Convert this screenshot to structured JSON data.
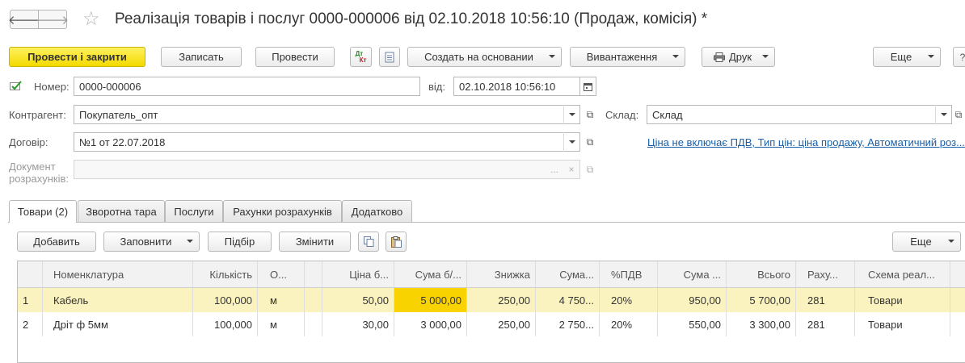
{
  "window": {
    "title": "Реалізація товарів і послуг 0000-000006 від 02.10.2018 10:56:10 (Продаж, комісія) *"
  },
  "toolbar": {
    "post_close": "Провести і закрити",
    "save": "Записать",
    "post": "Провести",
    "create_based": "Создать на основании",
    "upload": "Вивантаження",
    "print": "Друк",
    "more": "Еще",
    "dt_kt_top": "Дт",
    "dt_kt_bottom": "Кт"
  },
  "form": {
    "number_label": "Номер:",
    "number_value": "0000-000006",
    "date_label": "від:",
    "date_value": "02.10.2018 10:56:10",
    "counterparty_label": "Контрагент:",
    "counterparty_value": "Покупатель_опт",
    "warehouse_label": "Склад:",
    "warehouse_value": "Склад",
    "contract_label": "Договір:",
    "contract_value": "№1 от 22.07.2018",
    "price_link": "Ціна не включає ПДВ, Тип цін: ціна продажу, Автоматичний роз...",
    "settlement_label_1": "Документ",
    "settlement_label_2": "розрахунків:",
    "settlement_value": "",
    "dots": "...",
    "clear": "×"
  },
  "tabs": [
    {
      "label": "Товари (2)"
    },
    {
      "label": "Зворотна тара"
    },
    {
      "label": "Послуги"
    },
    {
      "label": "Рахунки розрахунків"
    },
    {
      "label": "Додатково"
    }
  ],
  "table_toolbar": {
    "add": "Добавить",
    "fill": "Заповнити",
    "select": "Підбір",
    "change": "Змінити",
    "more": "Еще"
  },
  "table": {
    "columns": [
      "",
      "Номенклатура",
      "Кількість",
      "О...",
      "",
      "Ціна б...",
      "Сума б/...",
      "Знижка",
      "Сума...",
      "%ПДВ",
      "Сума ...",
      "Всього",
      "Раху...",
      "Схема реал..."
    ],
    "rows": [
      [
        "1",
        "Кабель",
        "100,000",
        "м",
        "",
        "50,00",
        "5 000,00",
        "250,00",
        "4 750...",
        "20%",
        "950,00",
        "5 700,00",
        "281",
        "Товари"
      ],
      [
        "2",
        "Дріт ф 5мм",
        "100,000",
        "м",
        "",
        "30,00",
        "3 000,00",
        "250,00",
        "2 750...",
        "20%",
        "550,00",
        "3 300,00",
        "281",
        "Товари"
      ]
    ]
  },
  "colors": {
    "primary_button": "#f3d900",
    "selected_row": "#fbf3bf",
    "selected_cell": "#f9d300",
    "link": "#1a5fa8"
  }
}
